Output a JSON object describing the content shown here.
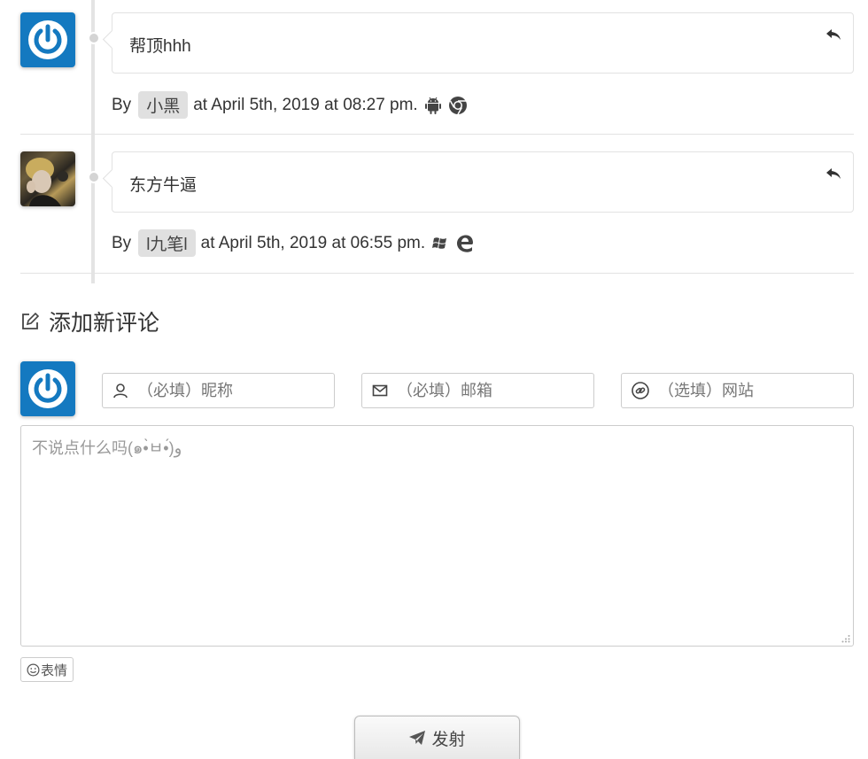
{
  "comments": [
    {
      "text": "帮顶hhh",
      "by": "By",
      "author": "小黑",
      "date": "at April 5th, 2019 at 08:27 pm.",
      "avatar_icon": "power-logo-icon",
      "os_icon": "android-icon",
      "browser_icon": "chrome-icon"
    },
    {
      "text": "东方牛逼",
      "by": "By",
      "author": "l九笔l",
      "date": "at April 5th, 2019 at 06:55 pm.",
      "avatar_icon": "user-photo",
      "os_icon": "windows-icon",
      "browser_icon": "edge-icon"
    }
  ],
  "form": {
    "title": "添加新评论",
    "name_placeholder": "（必填）昵称",
    "email_placeholder": "（必填）邮箱",
    "url_placeholder": "（选填）网站",
    "comment_placeholder": "不说点什么吗(๑•̀ㅂ•́)و",
    "emoji_label": "表情",
    "submit_label": "发射"
  },
  "colors": {
    "avatar_blue": "#1479c0",
    "timeline": "#e4e4e4",
    "author_badge": "#e0e0e0"
  }
}
